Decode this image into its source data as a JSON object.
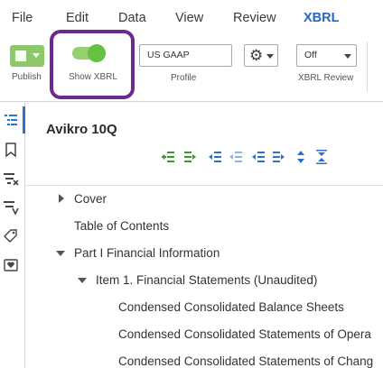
{
  "menu": {
    "items": [
      {
        "label": "File"
      },
      {
        "label": "Edit"
      },
      {
        "label": "Data"
      },
      {
        "label": "View"
      },
      {
        "label": "Review"
      },
      {
        "label": "XBRL",
        "active": true
      }
    ]
  },
  "ribbon": {
    "publish": {
      "label": "Publish",
      "icon": "publish-icon"
    },
    "show_xbrl": {
      "label": "Show XBRL",
      "toggle_on": true
    },
    "profile": {
      "value": "US GAAP",
      "label": "Profile"
    },
    "settings": {
      "icon": "gear-icon"
    },
    "xbrl_review": {
      "value": "Off",
      "label": "XBRL Review"
    }
  },
  "rail": {
    "icons": [
      "outline-icon",
      "bookmark-icon",
      "clear-filter-icon",
      "filter-icon",
      "tags-icon",
      "comment-heart-icon"
    ]
  },
  "document": {
    "title": "Avikro 10Q"
  },
  "toolbar": {
    "icons": [
      "add-section-icon",
      "indent-right-icon",
      "move-left-icon",
      "collapse-left-icon",
      "outdent-icon",
      "indent-arrow-icon",
      "expand-vertical-icon",
      "collapse-vertical-icon"
    ]
  },
  "tree": [
    {
      "label": "Cover",
      "toggle": "collapsed"
    },
    {
      "label": "Table of Contents",
      "toggle": "none"
    },
    {
      "label": "Part I Financial Information",
      "toggle": "expanded"
    },
    {
      "label": "Item 1. Financial Statements (Unaudited)",
      "toggle": "expanded"
    },
    {
      "label": "Condensed Consolidated Balance Sheets",
      "toggle": "none"
    },
    {
      "label": "Condensed Consolidated Statements of Opera",
      "toggle": "none"
    },
    {
      "label": "Condensed Consolidated Statements of Chang",
      "toggle": "none"
    }
  ],
  "colors": {
    "accent_blue": "#2365c9",
    "highlight_purple": "#6b2a91",
    "toggle_green": "#65c043",
    "icon_green": "#3a9a2c",
    "icon_blue": "#2f6fd0"
  }
}
